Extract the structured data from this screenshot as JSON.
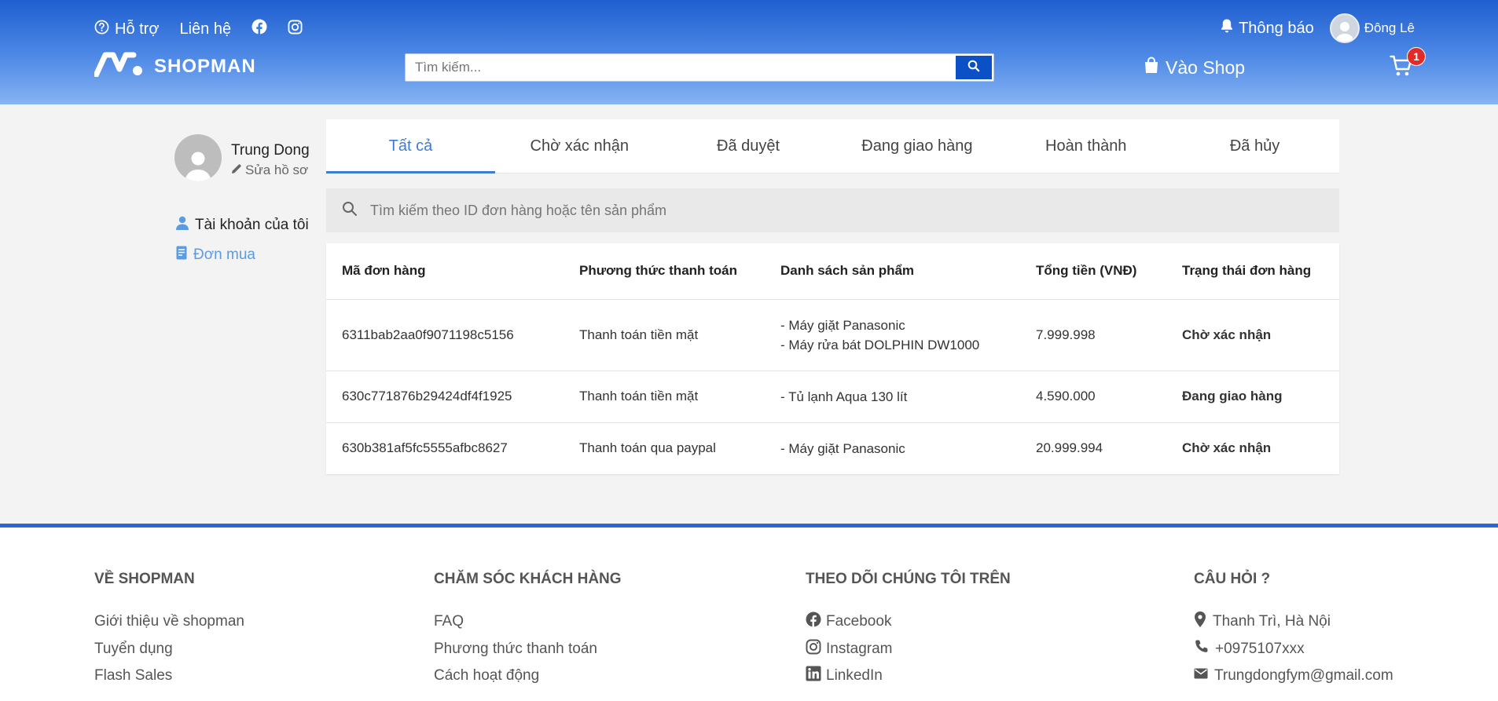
{
  "header": {
    "support_label": "Hỗ trợ",
    "contact_label": "Liên hệ",
    "notification_label": "Thông báo",
    "user_name": "Đông Lê",
    "logo_text": "SHOPMAN",
    "search_placeholder": "Tìm kiếm...",
    "shop_label": "Vào Shop",
    "cart_count": "1"
  },
  "sidebar": {
    "user_name": "Trung Dong",
    "edit_profile": "Sửa hồ sơ",
    "items": [
      {
        "label": "Tài khoản của tôi"
      },
      {
        "label": "Đơn mua"
      }
    ]
  },
  "tabs": [
    {
      "label": "Tất cả"
    },
    {
      "label": "Chờ xác nhận"
    },
    {
      "label": "Đã duyệt"
    },
    {
      "label": "Đang giao hàng"
    },
    {
      "label": "Hoàn thành"
    },
    {
      "label": "Đã hủy"
    }
  ],
  "order_search": {
    "placeholder": "Tìm kiếm theo ID đơn hàng hoặc tên sản phẩm"
  },
  "orders_table": {
    "headers": [
      "Mã đơn hàng",
      "Phương thức thanh toán",
      "Danh sách sản phẩm",
      "Tổng tiền (VNĐ)",
      "Trạng thái đơn hàng"
    ],
    "rows": [
      {
        "id": "6311bab2aa0f9071198c5156",
        "payment": "Thanh toán tiền mặt",
        "products": [
          "- Máy giặt Panasonic",
          "- Máy rửa bát DOLPHIN DW1000"
        ],
        "total": "7.999.998",
        "status": "Chờ xác nhận"
      },
      {
        "id": "630c771876b29424df4f1925",
        "payment": "Thanh toán tiền mặt",
        "products": [
          "- Tủ lạnh Aqua 130 lít"
        ],
        "total": "4.590.000",
        "status": "Đang giao hàng"
      },
      {
        "id": "630b381af5fc5555afbc8627",
        "payment": "Thanh toán qua paypal",
        "products": [
          "- Máy giặt Panasonic"
        ],
        "total": "20.999.994",
        "status": "Chờ xác nhận"
      }
    ]
  },
  "footer": {
    "about": {
      "title": "VỀ SHOPMAN",
      "links": [
        "Giới thiệu về shopman",
        "Tuyển dụng",
        "Flash Sales"
      ]
    },
    "care": {
      "title": "CHĂM SÓC KHÁCH HÀNG",
      "links": [
        "FAQ",
        "Phương thức thanh toán",
        "Cách hoạt động"
      ]
    },
    "follow": {
      "title": "THEO DÕI CHÚNG TÔI TRÊN",
      "links": [
        "Facebook",
        "Instagram",
        "LinkedIn"
      ]
    },
    "questions": {
      "title": "CÂU HỎI ?",
      "address": "Thanh Trì, Hà Nội",
      "phone": "+0975107xxx",
      "email": "Trungdongfym@gmail.com"
    }
  },
  "colors": {
    "brand_blue": "#2c66d2",
    "status_pending": "#f4b122",
    "status_shipping": "#3c7bd8",
    "badge_red": "#e02b27"
  }
}
